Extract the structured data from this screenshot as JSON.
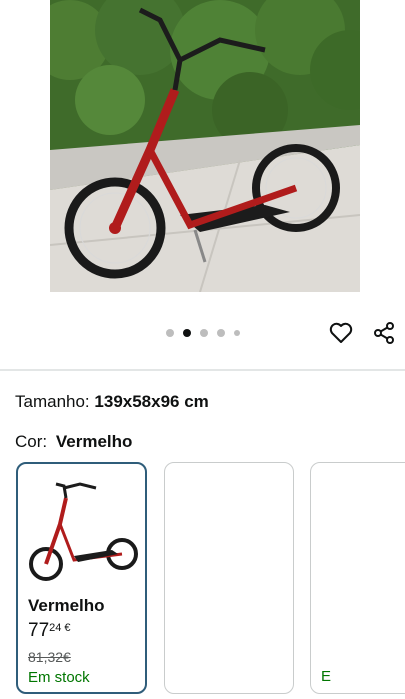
{
  "product": {
    "image_icon": "scooter-photo",
    "carousel": {
      "total": 5,
      "active": 2
    }
  },
  "actions": {
    "wishlist_icon": "heart-icon",
    "share_icon": "share-icon"
  },
  "variations": {
    "size_label": "Tamanho:",
    "size_value": "139x58x96 cm",
    "color_label": "Cor:",
    "color_value": "Vermelho",
    "swatches": [
      {
        "name": "Vermelho",
        "price_whole": "77",
        "price_frac": "24 €",
        "old_price": "81,32€",
        "stock": "Em stock",
        "selected": true
      },
      {
        "name": "",
        "selected": false
      },
      {
        "name": "",
        "stock": "E",
        "selected": false
      }
    ]
  },
  "colors": {
    "selected_border": "#2f5d7a",
    "stock_green": "#007600",
    "frame_red": "#b01c1c"
  }
}
